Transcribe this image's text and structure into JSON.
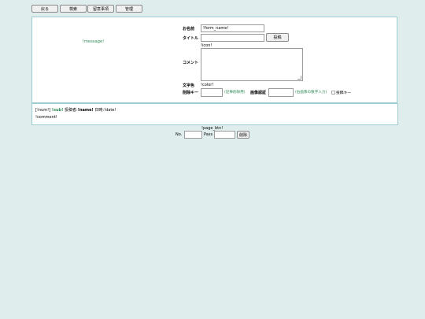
{
  "nav": {
    "back": "戻る",
    "search": "検索",
    "notice": "留意事項",
    "admin": "管理"
  },
  "form": {
    "message": "!message!",
    "name_label": "お名前",
    "name_value": "!form_name!",
    "title_label": "タイトル",
    "title_value": "",
    "submit": "投稿",
    "icon_text": "!icon!",
    "comment_label": "コメント",
    "comment_value": "",
    "color_label": "文字色",
    "color_text": "!color!",
    "delkey_label": "削除キー",
    "delkey_value": "",
    "delkey_hint": "(記事削除用)",
    "captcha_label": "画像認証",
    "captcha_value": "",
    "captcha_hint": "(右画像の数字入力)",
    "captcha_alt": "投稿キー"
  },
  "post": {
    "num": "[!num!]",
    "sub": "!sub!",
    "by_label": "投稿者:",
    "name": "!name!",
    "date_label": "日時:",
    "date": "!date!",
    "comment": "!comment!"
  },
  "footer": {
    "page_btn": "!page_btn!",
    "no_label": "No.",
    "no_value": "",
    "pass_label": "Pass",
    "pass_value": "",
    "delete": "削除"
  }
}
